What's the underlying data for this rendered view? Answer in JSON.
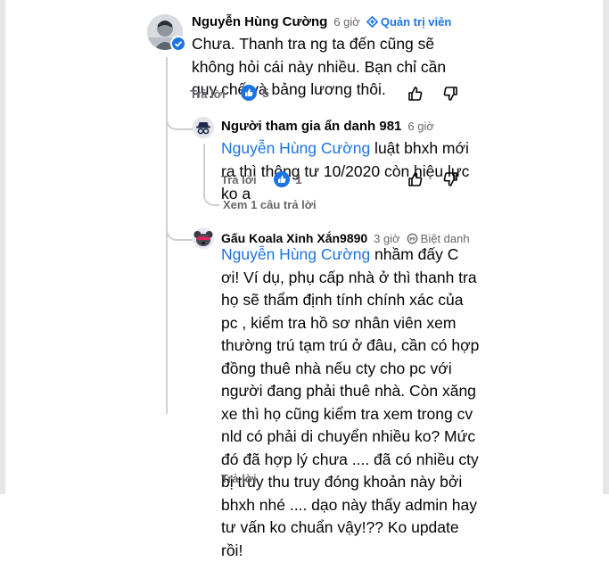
{
  "comments": [
    {
      "author": "Nguyễn Hùng Cường",
      "time": "6 giờ",
      "badge": "Quản trị viên",
      "text": "Chưa. Thanh tra ng ta đến cũng sẽ không hỏi cái này nhiều. Bạn chỉ cần quy chế và bảng lương thôi.",
      "reply_label": "Trả lời",
      "reactions": "5"
    },
    {
      "author": "Người tham gia ẩn danh 981",
      "time": "6 giờ",
      "mention": "Nguyễn Hùng Cường",
      "text": " luật bhxh mới ra thì thông tư 10/2020 còn hiệu lực ko a",
      "reply_label": "Trả lời",
      "reactions": "1",
      "view_replies": "Xem 1 câu trả lời"
    },
    {
      "author": "Gấu Koala Xinh Xắn9890",
      "time": "3 giờ",
      "badge": "Biệt danh",
      "mention": "Nguyễn Hùng Cường",
      "text": " nhầm đấy C ơi! Ví dụ, phụ cấp nhà ở thì thanh tra họ sẽ thẩm định tính chính xác của pc , kiểm tra hồ sơ nhân viên xem thường trú tạm trú ở đâu, cần có hợp đồng thuê nhà nếu cty cho pc với người đang phải thuê nhà. Còn xăng xe thì họ cũng kiểm tra xem trong cv nld có phải di chuyển nhiều ko? Mức đó đã hợp lý chưa .... đã có nhiều cty bị truy thu truy đóng khoản này bởi bhxh nhé .... dạo này thấy admin hay tư vấn ko chuẩn vậy!?? Ko update rồi!",
      "reply_label": "Trả lời"
    }
  ],
  "icons": [
    "like-icon",
    "dislike-icon",
    "admin-badge-icon",
    "nickname-badge-icon",
    "like-reaction-icon"
  ],
  "colors": {
    "accent": "#1b74e4",
    "muted": "#65676b",
    "thread": "#ced0d4"
  }
}
